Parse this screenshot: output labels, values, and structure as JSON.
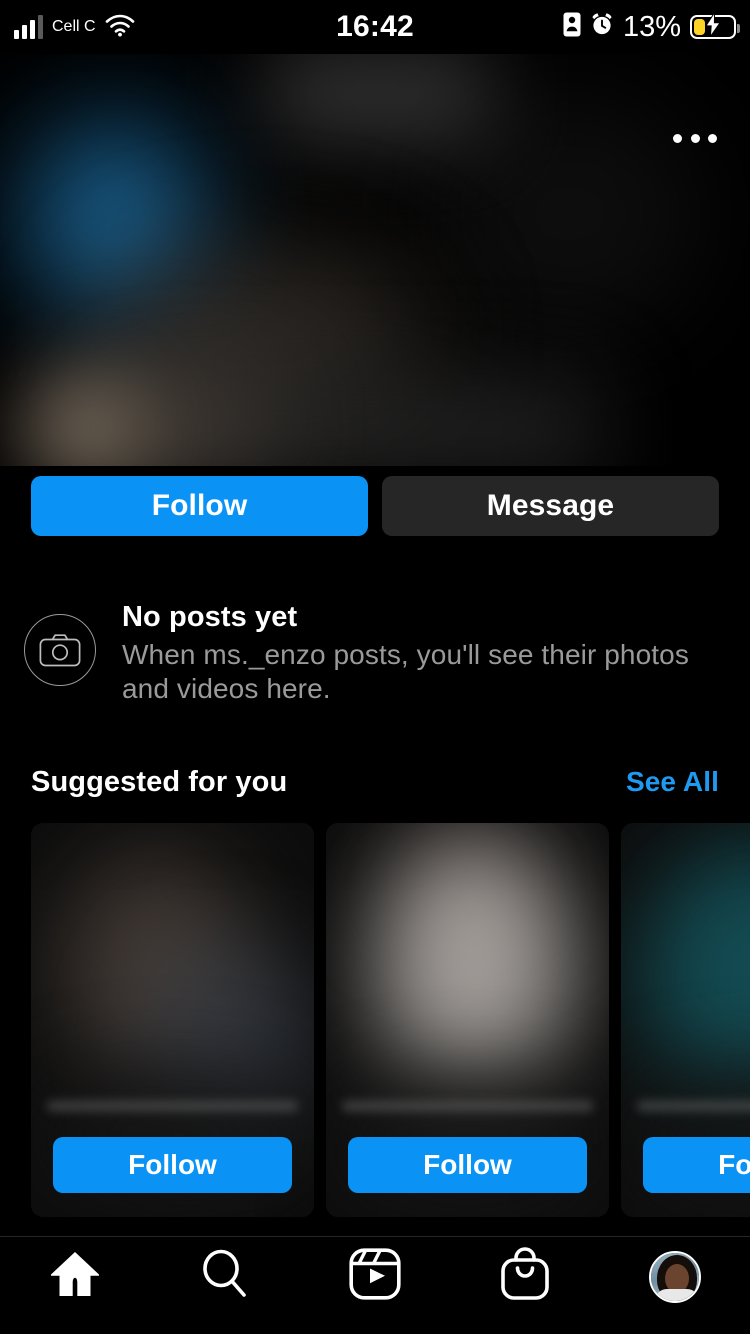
{
  "status_bar": {
    "carrier": "Cell C",
    "time": "16:42",
    "battery_percent": "13%",
    "signal_icon": "cellular-signal-icon",
    "wifi_icon": "wifi-icon",
    "orientation_lock_icon": "portrait-orientation-lock-icon",
    "alarm_icon": "alarm-clock-icon",
    "battery_icon": "battery-charging-icon",
    "battery_color": "#FFD426",
    "battery_level": 13
  },
  "header": {
    "more_label": "more-options",
    "more_icon": "ellipsis-icon"
  },
  "actions": {
    "follow_label": "Follow",
    "message_label": "Message",
    "follow_color": "#0A93F5",
    "message_color": "#262626"
  },
  "no_posts": {
    "icon": "camera-icon",
    "title": "No posts yet",
    "subtitle": "When ms._enzo posts, you'll see their photos and videos here.",
    "username": "ms._enzo"
  },
  "suggested": {
    "title": "Suggested for you",
    "see_all_label": "See All",
    "see_all_color": "#1E9AF0",
    "cards": [
      {
        "follow_label": "Follow"
      },
      {
        "follow_label": "Follow"
      },
      {
        "follow_label": "Follow"
      }
    ]
  },
  "bottom_nav": {
    "items": [
      {
        "name": "home",
        "icon": "home-icon",
        "active": true
      },
      {
        "name": "search",
        "icon": "search-icon",
        "active": false
      },
      {
        "name": "reels",
        "icon": "reels-icon",
        "active": false
      },
      {
        "name": "shop",
        "icon": "shopping-bag-icon",
        "active": false
      },
      {
        "name": "profile",
        "icon": "profile-avatar-icon",
        "active": false
      }
    ]
  },
  "theme": {
    "background": "#000000",
    "accent_blue": "#0A93F5",
    "surface": "#262626",
    "muted_text": "#9a9a9a"
  }
}
